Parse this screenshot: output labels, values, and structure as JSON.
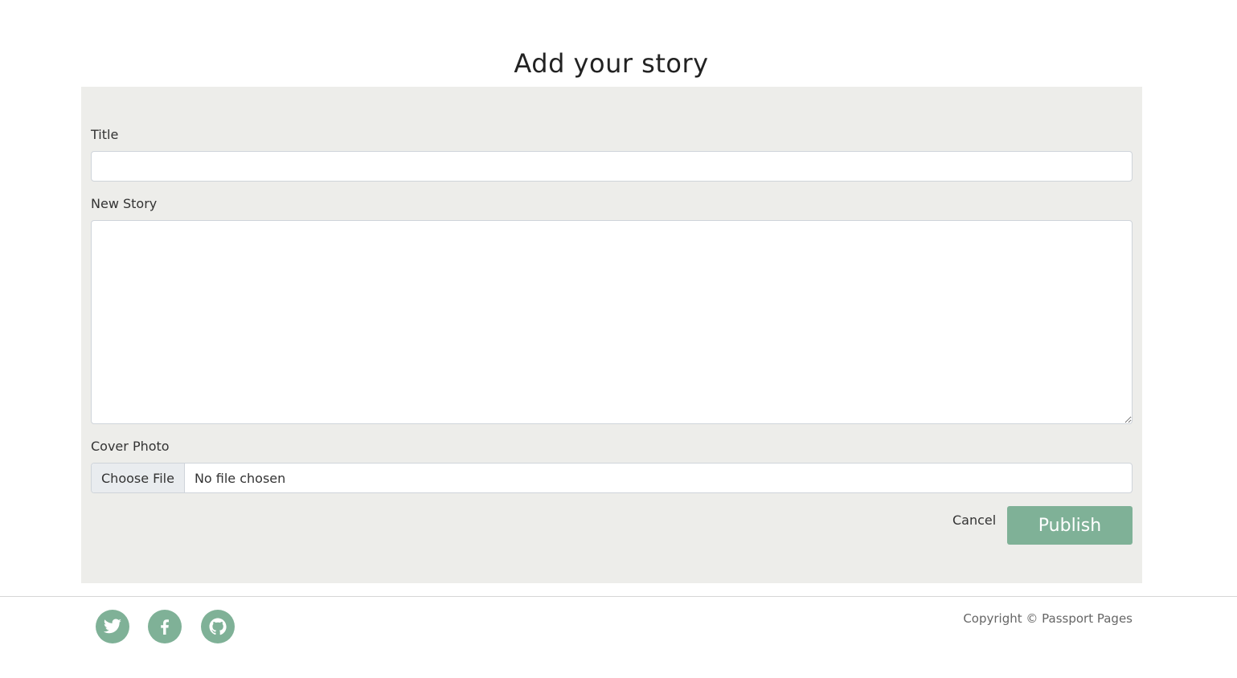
{
  "page": {
    "title": "Add your story"
  },
  "form": {
    "title_label": "Title",
    "title_value": "",
    "story_label": "New Story",
    "story_value": "",
    "cover_label": "Cover Photo",
    "choose_file_label": "Choose File",
    "file_status": "No file chosen",
    "cancel_label": "Cancel",
    "publish_label": "Publish"
  },
  "footer": {
    "social": [
      {
        "icon": "twitter-icon"
      },
      {
        "icon": "facebook-icon"
      },
      {
        "icon": "github-icon"
      }
    ],
    "copyright": "Copyright © Passport Pages"
  },
  "colors": {
    "accent": "#7fb197",
    "panel_background": "#ededea"
  }
}
